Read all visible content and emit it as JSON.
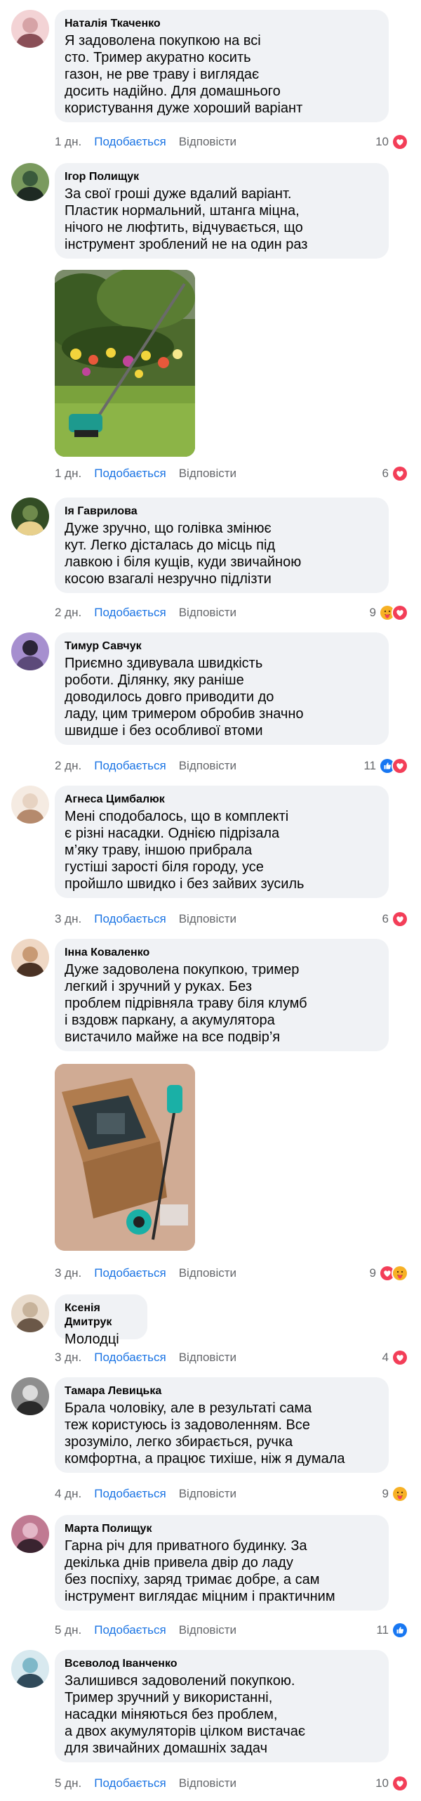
{
  "comments": [
    {
      "author": "Наталія Ткаченко",
      "text": "Я задоволена покупкою на всі\nсто. Тример акуратно косить\nгазон, не рве траву і виглядає\nдосить надійно. Для домашнього\nкористування дуже хороший варіант",
      "time": "1 дн.",
      "like": "Подобається",
      "reply": "Відповісти",
      "reactions": "10",
      "reaction_icons": [
        "heart"
      ]
    },
    {
      "author": "Ігор Полищук",
      "text": "За свої гроші дуже вдалий варіант.\nПластик нормальний, штанга міцна,\nнічого не люфтить, відчувається, що\nінструмент зроблений не на один раз",
      "time": "1 дн.",
      "like": "Подобається",
      "reply": "Відповісти",
      "reactions": "6",
      "reaction_icons": [
        "heart"
      ],
      "photo": "trimmer-garden-photo"
    },
    {
      "author": "Ія Гаврилова",
      "text": "Дуже зручно, що голівка змінює\nкут. Легко дісталась до місць під\nлавкою і біля кущів, куди звичайною\nкосою взагалі незручно підлізти",
      "time": "2 дн.",
      "like": "Подобається",
      "reply": "Відповісти",
      "reactions": "9",
      "reaction_icons": [
        "care",
        "heart"
      ]
    },
    {
      "author": "Тимур Савчук",
      "text": "Приємно здивувала швидкість\nроботи. Ділянку, яку раніше\nдоводилось довго приводити до\nладу, цим тримером обробив значно\nшвидше і без особливої втоми",
      "time": "2 дн.",
      "like": "Подобається",
      "reply": "Відповісти",
      "reactions": "11",
      "reaction_icons": [
        "like",
        "heart"
      ]
    },
    {
      "author": "Агнеса Цимбалюк",
      "text": "Мені сподобалось, що в комплекті\nє різні насадки. Однією підрізала\nм’яку траву, іншою прибрала\nгустіші зарості біля городу, усе\nпройшло швидко і без зайвих зусиль",
      "time": "3 дн.",
      "like": "Подобається",
      "reply": "Відповісти",
      "reactions": "6",
      "reaction_icons": [
        "heart"
      ]
    },
    {
      "author": "Інна Коваленко",
      "text": "Дуже задоволена покупкою, тример\nлегкий і зручний у руках. Без\nпроблем підрівняла траву біля клумб\nі вздовж паркану, а акумулятора\nвистачило майже на все подвір’я",
      "time": "3 дн.",
      "like": "Подобається",
      "reply": "Відповісти",
      "reactions": "9",
      "reaction_icons": [
        "heart",
        "care"
      ],
      "photo": "trimmer-unboxing-photo"
    },
    {
      "author": "Ксенія Дмитрук",
      "text": "Молодці",
      "time": "3 дн.",
      "like": "Подобається",
      "reply": "Відповісти",
      "reactions": "4",
      "reaction_icons": [
        "heart"
      ]
    },
    {
      "author": "Тамара Левицька",
      "text": "Брала чоловіку, але в результаті сама\nтеж користуюсь із задоволенням. Все\nзрозуміло, легко збирається, ручка\nкомфортна, а працює тихіше, ніж я думала",
      "time": "4 дн.",
      "like": "Подобається",
      "reply": "Відповісти",
      "reactions": "9",
      "reaction_icons": [
        "care"
      ]
    },
    {
      "author": "Марта Полищук",
      "text": "Гарна річ для приватного будинку. За\nдекілька днів привела двір до ладу\nбез поспіху, заряд тримає добре, а сам\nінструмент виглядає міцним і практичним",
      "time": "5 дн.",
      "like": "Подобається",
      "reply": "Відповісти",
      "reactions": "11",
      "reaction_icons": [
        "like"
      ]
    },
    {
      "author": "Всеволод Іванченко",
      "text": "Залишився задоволений покупкою.\nТример зручний у використанні,\nнасадки міняються без проблем,\nа двох акумуляторів цілком вистачає\nдля звичайних домашніх задач",
      "time": "5 дн.",
      "like": "Подобається",
      "reply": "Відповісти",
      "reactions": "10",
      "reaction_icons": [
        "heart"
      ]
    }
  ],
  "colors": {
    "bubble": "#f0f2f5",
    "like_link": "#1b74e4",
    "meta": "#65676b",
    "heart": "#f33e58",
    "like": "#1877f2",
    "care": "#f7b125"
  }
}
